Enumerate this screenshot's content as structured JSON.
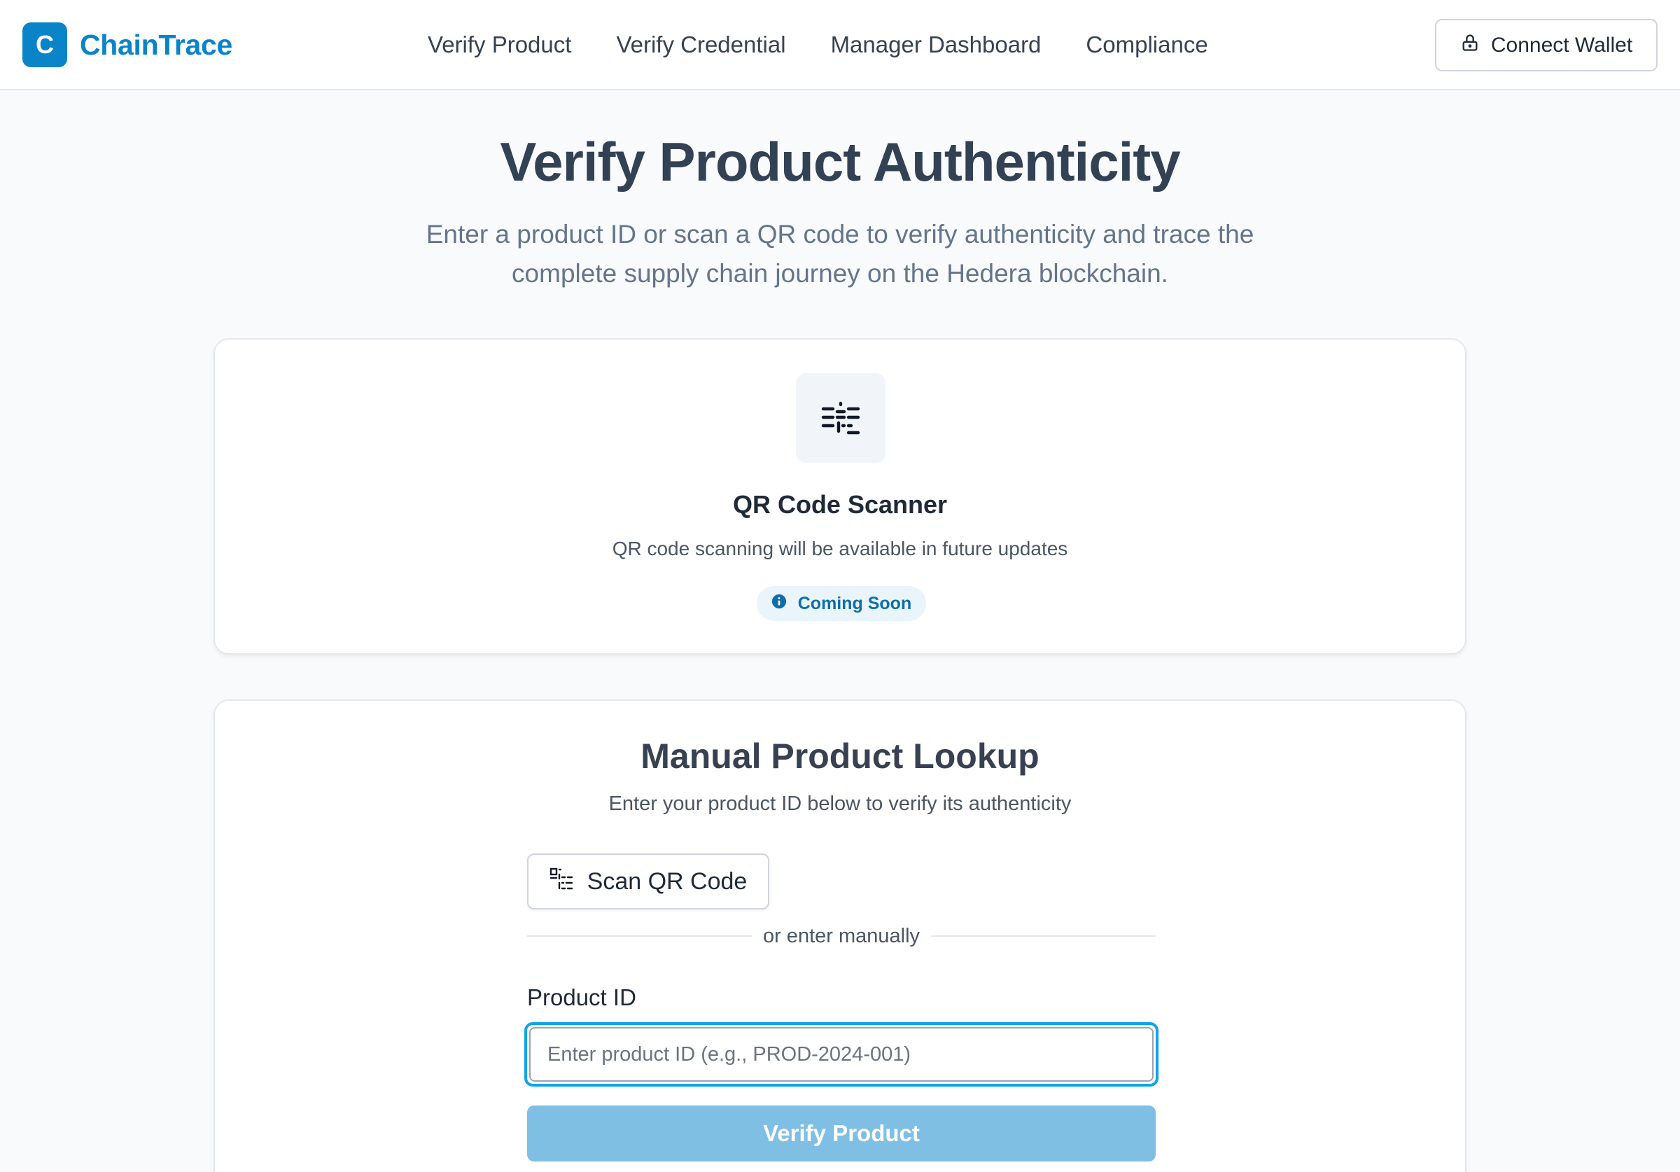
{
  "brand": {
    "logo_letter": "C",
    "name": "ChainTrace",
    "color": "#0a84c9"
  },
  "nav": {
    "items": [
      {
        "label": "Verify Product"
      },
      {
        "label": "Verify Credential"
      },
      {
        "label": "Manager Dashboard"
      },
      {
        "label": "Compliance"
      }
    ]
  },
  "wallet_button": {
    "label": "Connect Wallet",
    "icon": "lock-icon"
  },
  "hero": {
    "title": "Verify Product Authenticity",
    "subtitle": "Enter a product ID or scan a QR code to verify authenticity and trace the complete supply chain journey on the Hedera blockchain."
  },
  "qr_card": {
    "icon": "qr-scan-icon",
    "title": "QR Code Scanner",
    "description": "QR code scanning will be available in future updates",
    "badge": {
      "label": "Coming Soon",
      "icon": "info-icon"
    }
  },
  "manual_lookup": {
    "title": "Manual Product Lookup",
    "subtitle": "Enter your product ID below to verify its authenticity",
    "scan_button": {
      "label": "Scan QR Code",
      "icon": "qr-code-icon"
    },
    "divider_text": "or enter manually",
    "field_label": "Product ID",
    "input_value": "",
    "input_placeholder": "Enter product ID (e.g., PROD-2024-001)",
    "submit_label": "Verify Product"
  },
  "colors": {
    "accent": "#0a84c9",
    "focus_ring": "#0ea5e9",
    "disabled_button": "#7fbfe3",
    "badge_bg": "#eaf4fb"
  }
}
